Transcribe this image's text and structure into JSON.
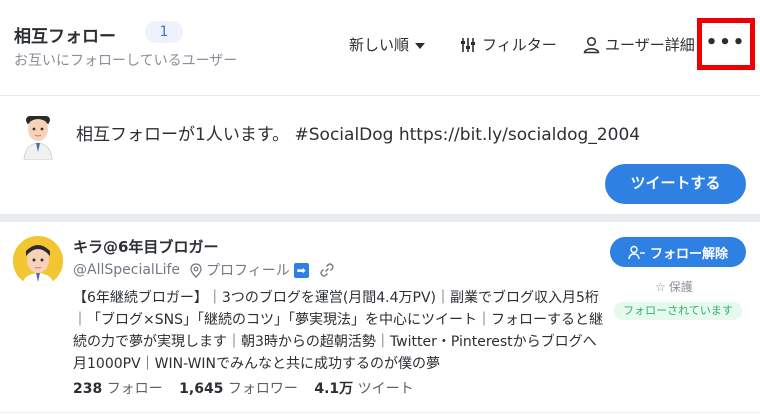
{
  "header": {
    "title": "相互フォロー",
    "count": "1",
    "subtitle": "お互いにフォローしているユーザー",
    "sort_label": "新しい順",
    "filter_label": "フィルター",
    "user_detail_label": "ユーザー詳細",
    "more_label": "•••",
    "highlight_color": "#f00000"
  },
  "composer": {
    "text": "相互フォローが1人います。 #SocialDog https://bit.ly/socialdog_2004",
    "tweet_button": "ツイートする"
  },
  "user": {
    "name": "キラ@6年目ブロガー",
    "handle": "@AllSpecialLife",
    "profile_label": "プロフィール",
    "bio": "【6年継続ブロガー】｜3つのブログを運営(月間4.4万PV)｜副業でブログ収入月5桁｜「ブログ×SNS」「継続のコツ」「夢実現法」を中心にツイート｜フォローすると継続の力で夢が実現します｜朝3時からの超朝活勢｜Twitter・Pinterestからブログへ月1000PV｜WIN-WINでみんなと共に成功するのが僕の夢",
    "following_count": "238",
    "following_label": "フォロー",
    "followers_count": "1,645",
    "followers_label": "フォロワー",
    "tweets_count": "4.1万",
    "tweets_label": "ツイート",
    "unfollow_button": "フォロー解除",
    "protect_label": "保護",
    "mutual_badge": "フォローされています"
  },
  "colors": {
    "accent": "#2f80e3",
    "mutual_green": "#2fb36a"
  }
}
